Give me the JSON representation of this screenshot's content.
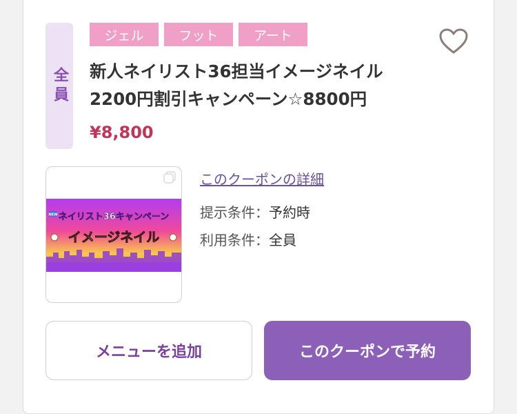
{
  "coupon": {
    "target_badge": "全員",
    "tags": [
      "ジェル",
      "フット",
      "アート"
    ],
    "title": "新人ネイリスト36担当イメージネイル2200円割引キャンペーン☆8800円",
    "price": "¥8,800",
    "favorite_icon": "heart-outline-icon",
    "thumbnail": {
      "line1": "ネイリスト36キャンペーン",
      "line2": "イメージネイル",
      "new_label": "NEW"
    },
    "detail_link": "このクーポンの詳細",
    "conditions": {
      "present_label": "提示条件：",
      "present_value": "予約時",
      "use_label": "利用条件：",
      "use_value": "全員"
    },
    "buttons": {
      "add_menu": "メニューを追加",
      "reserve": "このクーポンで予約"
    }
  },
  "colors": {
    "tag": "#f0a0c6",
    "badge_bg": "#ece2f3",
    "badge_text": "#8a4fb2",
    "price": "#c4345a",
    "reserve_button": "#8c5fb8"
  }
}
